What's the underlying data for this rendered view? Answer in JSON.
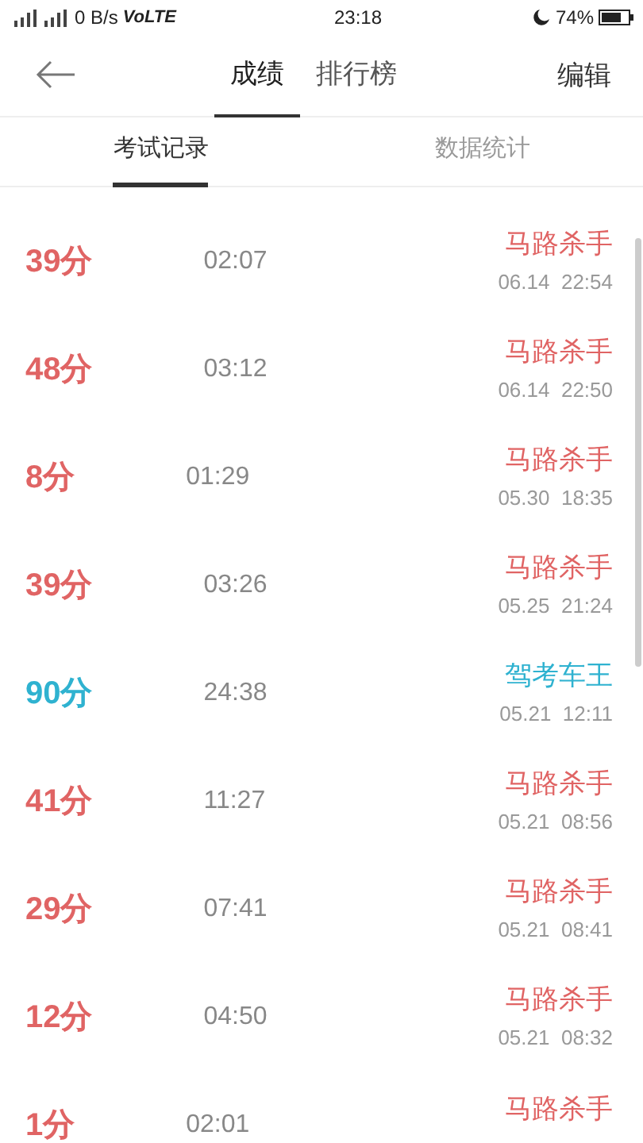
{
  "status_bar": {
    "network": "0 B/s",
    "volte": "VoLTE",
    "time": "23:18",
    "battery": "74%"
  },
  "header": {
    "tabs": [
      {
        "label": "成绩",
        "selected": true
      },
      {
        "label": "排行榜",
        "selected": false
      }
    ],
    "action": "编辑"
  },
  "sub_tabs": [
    {
      "label": "考试记录",
      "selected": true
    },
    {
      "label": "数据统计",
      "selected": false
    }
  ],
  "records": [
    {
      "score": "39分",
      "duration": "02:07",
      "title": "马路杀手",
      "date": "06.14  22:54",
      "passed": false
    },
    {
      "score": "48分",
      "duration": "03:12",
      "title": "马路杀手",
      "date": "06.14  22:50",
      "passed": false
    },
    {
      "score": "8分",
      "duration": "01:29",
      "title": "马路杀手",
      "date": "05.30  18:35",
      "passed": false
    },
    {
      "score": "39分",
      "duration": "03:26",
      "title": "马路杀手",
      "date": "05.25  21:24",
      "passed": false
    },
    {
      "score": "90分",
      "duration": "24:38",
      "title": "驾考车王",
      "date": "05.21  12:11",
      "passed": true
    },
    {
      "score": "41分",
      "duration": "11:27",
      "title": "马路杀手",
      "date": "05.21  08:56",
      "passed": false
    },
    {
      "score": "29分",
      "duration": "07:41",
      "title": "马路杀手",
      "date": "05.21  08:41",
      "passed": false
    },
    {
      "score": "12分",
      "duration": "04:50",
      "title": "马路杀手",
      "date": "05.21  08:32",
      "passed": false
    },
    {
      "score": "1分",
      "duration": "02:01",
      "title": "马路杀手",
      "passed": false
    }
  ]
}
